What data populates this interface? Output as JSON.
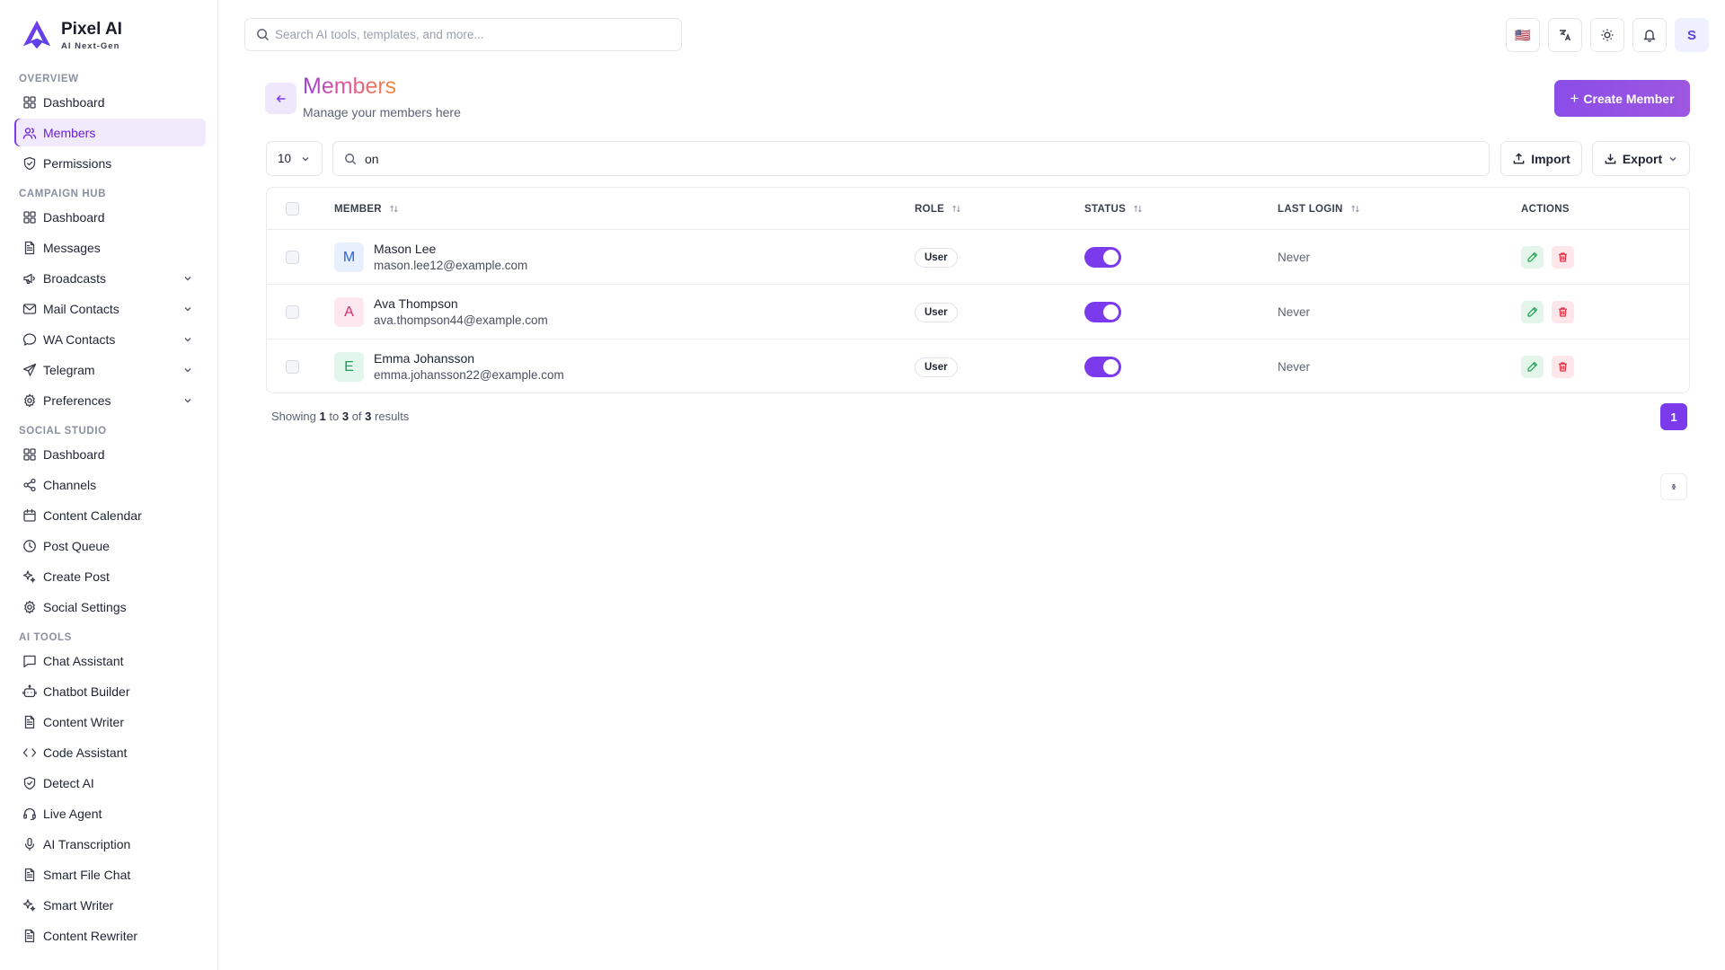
{
  "brand": {
    "name": "Pixel AI",
    "tagline": "AI Next-Gen"
  },
  "search": {
    "placeholder": "Search AI tools, templates, and more..."
  },
  "topbar": {
    "flag": "🇺🇸",
    "avatar_initial": "S"
  },
  "sidebar": {
    "sections": [
      {
        "label": "OVERVIEW",
        "items": [
          {
            "label": "Dashboard",
            "icon": "dashboard-icon"
          },
          {
            "label": "Members",
            "icon": "users-icon",
            "active": true
          },
          {
            "label": "Permissions",
            "icon": "shield-icon"
          }
        ]
      },
      {
        "label": "CAMPAIGN HUB",
        "items": [
          {
            "label": "Dashboard",
            "icon": "dashboard-icon"
          },
          {
            "label": "Messages",
            "icon": "document-icon"
          },
          {
            "label": "Broadcasts",
            "icon": "megaphone-icon",
            "expandable": true
          },
          {
            "label": "Mail Contacts",
            "icon": "mail-icon",
            "expandable": true
          },
          {
            "label": "WA Contacts",
            "icon": "chat-bubble-icon",
            "expandable": true
          },
          {
            "label": "Telegram",
            "icon": "send-icon",
            "expandable": true
          },
          {
            "label": "Preferences",
            "icon": "gear-icon",
            "expandable": true
          }
        ]
      },
      {
        "label": "SOCIAL STUDIO",
        "items": [
          {
            "label": "Dashboard",
            "icon": "dashboard-icon"
          },
          {
            "label": "Channels",
            "icon": "share-icon"
          },
          {
            "label": "Content Calendar",
            "icon": "calendar-icon"
          },
          {
            "label": "Post Queue",
            "icon": "clock-icon"
          },
          {
            "label": "Create Post",
            "icon": "sparkle-icon"
          },
          {
            "label": "Social Settings",
            "icon": "gear-icon"
          }
        ]
      },
      {
        "label": "AI TOOLS",
        "items": [
          {
            "label": "Chat Assistant",
            "icon": "chat-square-icon"
          },
          {
            "label": "Chatbot Builder",
            "icon": "bot-icon"
          },
          {
            "label": "Content Writer",
            "icon": "document-icon"
          },
          {
            "label": "Code Assistant",
            "icon": "code-icon"
          },
          {
            "label": "Detect AI",
            "icon": "shield-icon"
          },
          {
            "label": "Live Agent",
            "icon": "headset-icon"
          },
          {
            "label": "AI Transcription",
            "icon": "mic-icon"
          },
          {
            "label": "Smart File Chat",
            "icon": "document-icon"
          },
          {
            "label": "Smart Writer",
            "icon": "sparkle-icon"
          },
          {
            "label": "Content Rewriter",
            "icon": "document-icon"
          }
        ]
      }
    ]
  },
  "page": {
    "title": "Members",
    "subtitle": "Manage your members here",
    "create_label": "Create Member"
  },
  "toolbar": {
    "per_page": "10",
    "search_value": "on",
    "import_label": "Import",
    "export_label": "Export"
  },
  "table": {
    "columns": [
      "MEMBER",
      "ROLE",
      "STATUS",
      "LAST LOGIN",
      "ACTIONS"
    ],
    "rows": [
      {
        "initial": "M",
        "name": "Mason Lee",
        "email": "mason.lee12@example.com",
        "role": "User",
        "status_on": true,
        "last_login": "Never",
        "avatar_bg": "#e8f0fd",
        "avatar_fg": "#2a62d6"
      },
      {
        "initial": "A",
        "name": "Ava Thompson",
        "email": "ava.thompson44@example.com",
        "role": "User",
        "status_on": true,
        "last_login": "Never",
        "avatar_bg": "#fde8ef",
        "avatar_fg": "#d92a6a"
      },
      {
        "initial": "E",
        "name": "Emma Johansson",
        "email": "emma.johansson22@example.com",
        "role": "User",
        "status_on": true,
        "last_login": "Never",
        "avatar_bg": "#e3f6ec",
        "avatar_fg": "#1e9a5b"
      }
    ]
  },
  "footer": {
    "showing_prefix": "Showing",
    "from": "1",
    "to_word": "to",
    "to": "3",
    "of_word": "of",
    "total": "3",
    "results_word": "results",
    "current_page": "1"
  },
  "colors": {
    "accent": "#7c3aed",
    "edit": "#22a55a",
    "delete": "#e1364a"
  }
}
